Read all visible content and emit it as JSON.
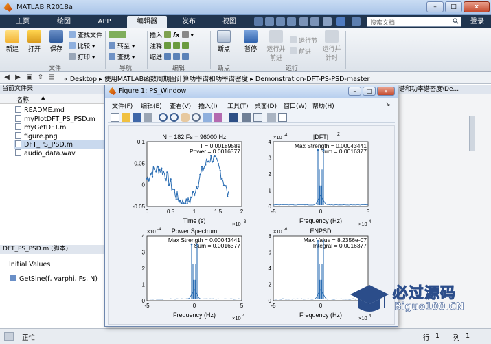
{
  "window": {
    "title": "MATLAB R2018a",
    "close_glyph": "x"
  },
  "tabs": [
    "主页",
    "绘图",
    "APP",
    "编辑器",
    "发布",
    "视图"
  ],
  "active_tab": "编辑器",
  "search": {
    "placeholder": "搜索文档"
  },
  "login_label": "登录",
  "ribbon": {
    "file": {
      "new": "新建",
      "open": "打开",
      "save": "保存",
      "find_files": "查找文件",
      "compare": "比较",
      "print": "打印",
      "group": "文件"
    },
    "nav": {
      "goto": "转至",
      "find": "查找",
      "group": "导航"
    },
    "edit": {
      "insert": "插入",
      "comment": "注释",
      "indent": "缩进",
      "fx": "fx",
      "group": "编辑"
    },
    "breakpoints": {
      "label": "断点",
      "group": "断点"
    },
    "run": {
      "pause": "暂停",
      "run_advance_1": "运行并",
      "run_advance_2": "前进",
      "run_section": "运行节",
      "advance": "前进",
      "run_time_1": "运行并",
      "run_time_2": "计时",
      "group": "运行"
    }
  },
  "addressbar": {
    "path_prefix": "«  Desktop  ▸  使用MATLAB函数周期图计算功率谱和功率谱密度  ▸  Demonstration-DFT-PS-PSD-master"
  },
  "current_folder": {
    "title": "当前文件夹",
    "col_name": "名称",
    "sort_glyph": "▲",
    "files": [
      {
        "name": "README.md",
        "selected": false
      },
      {
        "name": "myPlotDFT_PS_PSD.m",
        "selected": false
      },
      {
        "name": "myGetDFT.m",
        "selected": false
      },
      {
        "name": "figure.png",
        "selected": false
      },
      {
        "name": "DFT_PS_PSD.m",
        "selected": true
      },
      {
        "name": "audio_data.wav",
        "selected": false
      }
    ]
  },
  "details": {
    "title": "DFT_PS_PSD.m  (脚本)",
    "section": "Initial Values",
    "item": "GetSine(f, varphi, Fs, N)"
  },
  "workspace_header": "谱和功率谱密度\\De...",
  "statusbar": {
    "status": "正忙",
    "row_label": "行",
    "row_value": "1",
    "col_label": "列",
    "col_value": "1"
  },
  "figure": {
    "title": "Figure 1: PS_Window",
    "menus": [
      "文件(F)",
      "编辑(E)",
      "查看(V)",
      "插入(I)",
      "工具(T)",
      "桌面(D)",
      "窗口(W)",
      "帮助(H)"
    ],
    "plots": [
      {
        "title": "N = 182    Fs = 96000 Hz",
        "xlabel": "Time (s)",
        "xexp": "×10",
        "xexp_power": "-3",
        "annot1": "T = 0.0018958s",
        "annot2": "Power = 0.0016377",
        "xticks": [
          "0",
          "0.5",
          "1",
          "1.5",
          "2"
        ],
        "yticks": [
          "0.1",
          "0.05",
          "0",
          "-0.05"
        ],
        "yexp": "",
        "yexp_power": ""
      },
      {
        "title": "|DFT|",
        "title_sup": "2",
        "xlabel": "Frequency (Hz)",
        "xexp": "×10",
        "xexp_power": "4",
        "annot1": "Max Strength = 0.00043441",
        "annot2": "Sum = 0.0016377",
        "xticks": [
          "-5",
          "0",
          "5"
        ],
        "yticks": [
          "4",
          "3",
          "2",
          "1",
          "0"
        ],
        "yexp": "×10",
        "yexp_power": "-4"
      },
      {
        "title": "Power Spectrum",
        "xlabel": "Frequency (Hz)",
        "xexp": "×10",
        "xexp_power": "4",
        "annot1": "Max Strength = 0.00043441",
        "annot2": "Sum = 0.0016377",
        "xticks": [
          "-5",
          "0",
          "5"
        ],
        "yticks": [
          "4",
          "3",
          "2",
          "1",
          "0"
        ],
        "yexp": "×10",
        "yexp_power": "-4"
      },
      {
        "title": "ENPSD",
        "xlabel": "Frequency (Hz)",
        "xexp": "×10",
        "xexp_power": "4",
        "annot1": "Max Value = 8.2356e-07",
        "annot2": "Integral = 0.0016377",
        "xticks": [
          "-5",
          "0",
          "5"
        ],
        "yticks": [
          "8",
          "6",
          "4",
          "2",
          "0"
        ],
        "yexp": "×10",
        "yexp_power": "-6"
      }
    ]
  },
  "watermark": {
    "cn": "必过源码",
    "en": "Biguo100.CN"
  },
  "colors": {
    "plot_line": "#2a6db3",
    "toolstrip": "#20354f",
    "active_tab": "#e9eef4"
  }
}
